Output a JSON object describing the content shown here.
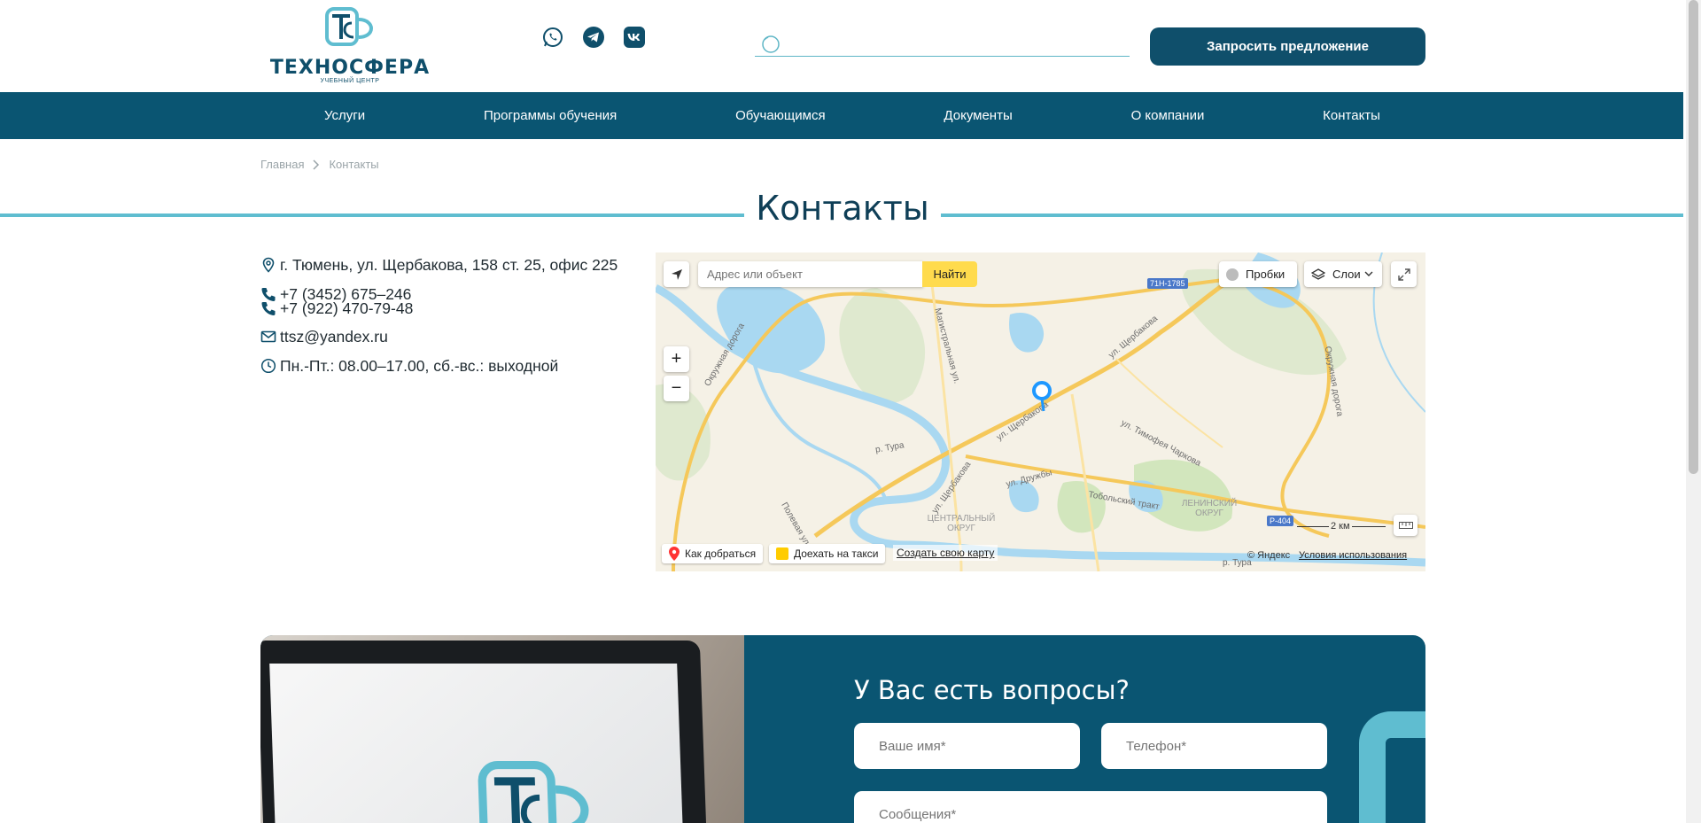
{
  "header": {
    "logo_text": "ТЕХНОСФЕРА",
    "logo_subtext": "УЧЕБНЫЙ ЦЕНТР",
    "logo_icon_letters": "ТС",
    "socials": [
      "whatsapp-icon",
      "telegram-icon",
      "vk-icon"
    ],
    "request_button": "Запросить предложение",
    "search_value": ""
  },
  "nav": {
    "items": [
      "Услуги",
      "Программы обучения",
      "Обучающимся",
      "Документы",
      "О компании",
      "Контакты"
    ]
  },
  "breadcrumb": {
    "home": "Главная",
    "current": "Контакты"
  },
  "page_title": "Контакты",
  "contacts": {
    "address": "г. Тюмень, ул. Щербакова, 158 ст. 25, офис 225",
    "phone1": "+7 (3452) 675–246",
    "phone2": "+7 (922) 470-79-48",
    "email": "ttsz@yandex.ru",
    "hours": "Пн.-Пт.: 08.00–17.00, сб.-вс.: выходной"
  },
  "map": {
    "search_placeholder": "Адрес или объект",
    "find_button": "Найти",
    "traffic": "Пробки",
    "layers": "Слои",
    "route": "Как добраться",
    "taxi": "Доехать на такси",
    "create_map": "Создать свою карту",
    "copyright": "© Яндекс",
    "terms": "Условия использования",
    "scale": "2 км",
    "zoom_in": "+",
    "zoom_out": "−",
    "labels": {
      "okruzh_left": "Окружная дорога",
      "magistralnaya": "Магистральная ул.",
      "tura1": "р. Тура",
      "tura2": "р. Тура",
      "scherbakova1": "ул. Щербакова",
      "scherbakova2": "ул. Щербакова",
      "scherbakova3": "ул. Щербакова",
      "druzhby": "ул. Дружбы",
      "tobolsky": "Тобольский тракт",
      "charkova": "ул. Тимофея Чаркова",
      "okruzh_right": "Окружная дорога",
      "tsentr": "ЦЕНТРАЛЬНЫЙ ОКРУГ",
      "leninsky": "ЛЕНИНСКИЙ ОКРУГ",
      "polevaya": "Полевая ул.",
      "road_71h": "71Н-1785",
      "road_r404": "Р-404",
      "okruzh_bottom": "Окружная дорога"
    }
  },
  "form": {
    "title": "У Вас есть вопросы?",
    "name_placeholder": "Ваше имя*",
    "phone_placeholder": "Телефон*",
    "message_placeholder": "Сообщения*"
  },
  "colors": {
    "primary": "#0a5572",
    "accent": "#5fbdd0",
    "map_find": "#ffdb4d"
  }
}
